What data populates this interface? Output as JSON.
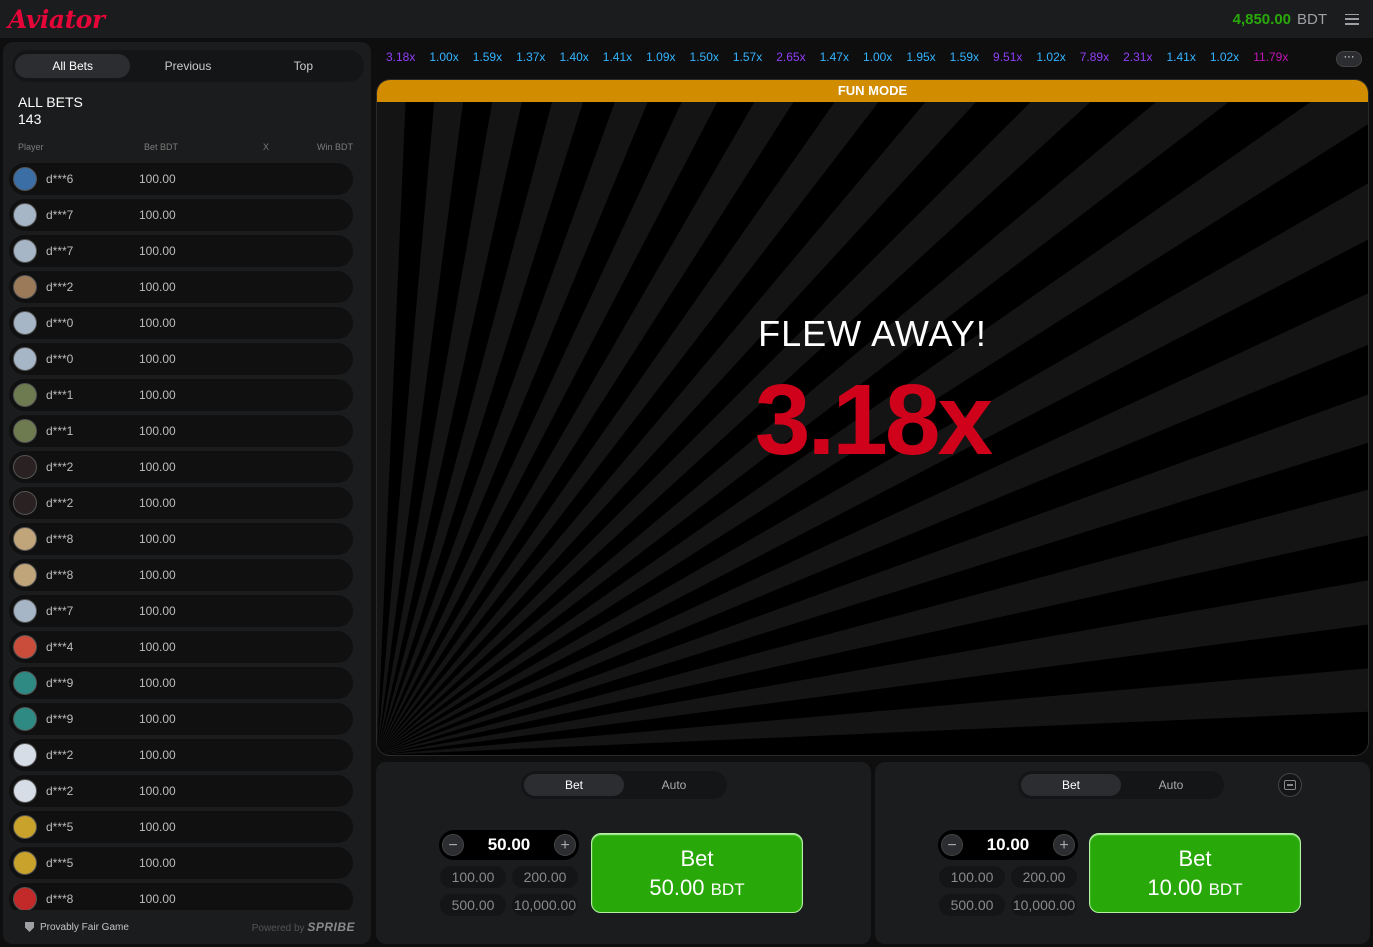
{
  "header": {
    "logo": "Aviator",
    "balance_amount": "4,850.00",
    "balance_currency": "BDT",
    "menu_icon": "hamburger-menu-icon"
  },
  "sidebar": {
    "tabs": [
      {
        "label": "All Bets",
        "active": true
      },
      {
        "label": "Previous",
        "active": false
      },
      {
        "label": "Top",
        "active": false
      }
    ],
    "title": "ALL BETS",
    "count": "143",
    "columns": {
      "player": "Player",
      "bet": "Bet BDT",
      "x": "X",
      "win": "Win BDT"
    },
    "rows": [
      {
        "player": "d***6",
        "bet": "100.00",
        "avatar_color": "#3a6ea5"
      },
      {
        "player": "d***7",
        "bet": "100.00",
        "avatar_color": "#a7b6c6"
      },
      {
        "player": "d***7",
        "bet": "100.00",
        "avatar_color": "#a7b6c6"
      },
      {
        "player": "d***2",
        "bet": "100.00",
        "avatar_color": "#9b7a5a"
      },
      {
        "player": "d***0",
        "bet": "100.00",
        "avatar_color": "#a7b6c6"
      },
      {
        "player": "d***0",
        "bet": "100.00",
        "avatar_color": "#a7b6c6"
      },
      {
        "player": "d***1",
        "bet": "100.00",
        "avatar_color": "#6e7a4f"
      },
      {
        "player": "d***1",
        "bet": "100.00",
        "avatar_color": "#6e7a4f"
      },
      {
        "player": "d***2",
        "bet": "100.00",
        "avatar_color": "#2a2222"
      },
      {
        "player": "d***2",
        "bet": "100.00",
        "avatar_color": "#2a2222"
      },
      {
        "player": "d***8",
        "bet": "100.00",
        "avatar_color": "#c0a47a"
      },
      {
        "player": "d***8",
        "bet": "100.00",
        "avatar_color": "#c0a47a"
      },
      {
        "player": "d***7",
        "bet": "100.00",
        "avatar_color": "#a7b6c6"
      },
      {
        "player": "d***4",
        "bet": "100.00",
        "avatar_color": "#c94d3a"
      },
      {
        "player": "d***9",
        "bet": "100.00",
        "avatar_color": "#2e8a83"
      },
      {
        "player": "d***9",
        "bet": "100.00",
        "avatar_color": "#2e8a83"
      },
      {
        "player": "d***2",
        "bet": "100.00",
        "avatar_color": "#d7dde6"
      },
      {
        "player": "d***2",
        "bet": "100.00",
        "avatar_color": "#d7dde6"
      },
      {
        "player": "d***5",
        "bet": "100.00",
        "avatar_color": "#c8a22a"
      },
      {
        "player": "d***5",
        "bet": "100.00",
        "avatar_color": "#c8a22a"
      },
      {
        "player": "d***8",
        "bet": "100.00",
        "avatar_color": "#c22a2a"
      }
    ],
    "footer": {
      "provably_fair": "Provably Fair Game",
      "powered_by": "Powered by",
      "brand": "SPRIBE"
    }
  },
  "history": [
    {
      "value": "3.18x",
      "color": "#913ef8"
    },
    {
      "value": "1.00x",
      "color": "#34b4ff"
    },
    {
      "value": "1.59x",
      "color": "#34b4ff"
    },
    {
      "value": "1.37x",
      "color": "#34b4ff"
    },
    {
      "value": "1.40x",
      "color": "#34b4ff"
    },
    {
      "value": "1.41x",
      "color": "#34b4ff"
    },
    {
      "value": "1.09x",
      "color": "#34b4ff"
    },
    {
      "value": "1.50x",
      "color": "#34b4ff"
    },
    {
      "value": "1.57x",
      "color": "#34b4ff"
    },
    {
      "value": "2.65x",
      "color": "#913ef8"
    },
    {
      "value": "1.47x",
      "color": "#34b4ff"
    },
    {
      "value": "1.00x",
      "color": "#34b4ff"
    },
    {
      "value": "1.95x",
      "color": "#34b4ff"
    },
    {
      "value": "1.59x",
      "color": "#34b4ff"
    },
    {
      "value": "9.51x",
      "color": "#913ef8"
    },
    {
      "value": "1.02x",
      "color": "#34b4ff"
    },
    {
      "value": "7.89x",
      "color": "#913ef8"
    },
    {
      "value": "2.31x",
      "color": "#913ef8"
    },
    {
      "value": "1.41x",
      "color": "#34b4ff"
    },
    {
      "value": "1.02x",
      "color": "#34b4ff"
    },
    {
      "value": "11.79x",
      "color": "#c017b4"
    }
  ],
  "history_more_label": "···",
  "game": {
    "banner": "FUN MODE",
    "message": "FLEW AWAY!",
    "multiplier": "3.18x",
    "accent_color": "#d0021b"
  },
  "panels": [
    {
      "tabs": [
        {
          "label": "Bet",
          "active": true
        },
        {
          "label": "Auto",
          "active": false
        }
      ],
      "amount": "50.00",
      "quick": [
        "100.00",
        "200.00",
        "500.00",
        "10,000.00"
      ],
      "bet_label": "Bet",
      "bet_amount": "50.00",
      "bet_currency": "BDT"
    },
    {
      "tabs": [
        {
          "label": "Bet",
          "active": true
        },
        {
          "label": "Auto",
          "active": false
        }
      ],
      "amount": "10.00",
      "quick": [
        "100.00",
        "200.00",
        "500.00",
        "10,000.00"
      ],
      "bet_label": "Bet",
      "bet_amount": "10.00",
      "bet_currency": "BDT",
      "remove_icon": "remove-panel-icon"
    }
  ]
}
